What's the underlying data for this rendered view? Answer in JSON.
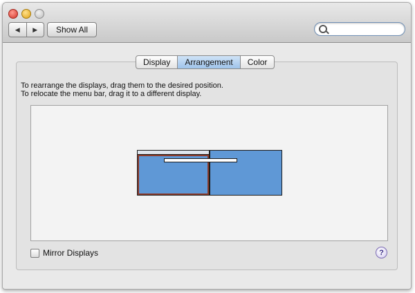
{
  "toolbar": {
    "back_icon": "back-arrow-icon",
    "forward_icon": "forward-arrow-icon",
    "back_glyph": "◀",
    "forward_glyph": "▶",
    "show_all_label": "Show All",
    "search_placeholder": ""
  },
  "tabs": [
    {
      "label": "Display",
      "selected": false
    },
    {
      "label": "Arrangement",
      "selected": true
    },
    {
      "label": "Color",
      "selected": false
    }
  ],
  "instructions": {
    "line1": "To rearrange the displays, drag them to the desired position.",
    "line2": "To relocate the menu bar, drag it to a different display."
  },
  "arrangement": {
    "displays": [
      {
        "name": "main-display",
        "selected": true,
        "has_menu_bar": true,
        "color": "#5f98d6"
      },
      {
        "name": "secondary-display",
        "selected": false,
        "has_menu_bar": false,
        "color": "#5f98d6"
      }
    ]
  },
  "footer": {
    "mirror_label": "Mirror Displays",
    "mirror_checked": false,
    "help_glyph": "?"
  },
  "colors": {
    "window_bg": "#e9e9e9",
    "selected_tab": "#9fc3ea",
    "display_fill": "#5f98d6",
    "selection_outline": "#8a3b2c"
  }
}
